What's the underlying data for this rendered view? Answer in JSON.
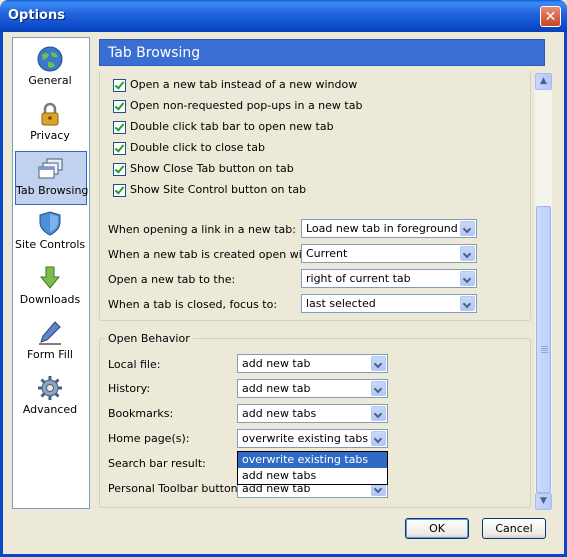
{
  "window": {
    "title": "Options",
    "close_glyph": "✕"
  },
  "sidebar": {
    "items": [
      {
        "label": "General",
        "icon": "globe-icon"
      },
      {
        "label": "Privacy",
        "icon": "lock-icon"
      },
      {
        "label": "Tab Browsing",
        "icon": "windows-icon",
        "selected": true
      },
      {
        "label": "Site Controls",
        "icon": "shield-icon"
      },
      {
        "label": "Downloads",
        "icon": "download-arrow-icon"
      },
      {
        "label": "Form Fill",
        "icon": "pen-icon"
      },
      {
        "label": "Advanced",
        "icon": "gear-icon"
      }
    ]
  },
  "header": {
    "title": "Tab Browsing"
  },
  "checkboxes": [
    {
      "label": "Open a new tab instead of a new window",
      "checked": true
    },
    {
      "label": "Open non-requested pop-ups in a new tab",
      "checked": true
    },
    {
      "label": "Double click tab bar to open new tab",
      "checked": true
    },
    {
      "label": "Double click to close tab",
      "checked": true
    },
    {
      "label": "Show Close Tab button on tab",
      "checked": true
    },
    {
      "label": "Show Site Control button on tab",
      "checked": true
    }
  ],
  "tab_settings": [
    {
      "label": "When opening a link in a new tab:",
      "value": "Load new tab in foreground"
    },
    {
      "label": "When a new tab is created open with:",
      "value": "Current"
    },
    {
      "label": "Open a new tab to the:",
      "value": "right of current tab"
    },
    {
      "label": "When a tab is closed, focus to:",
      "value": "last selected"
    }
  ],
  "open_behavior": {
    "legend": "Open Behavior",
    "rows": [
      {
        "label": "Local file:",
        "value": "add new tab"
      },
      {
        "label": "History:",
        "value": "add new tab"
      },
      {
        "label": "Bookmarks:",
        "value": "add new tabs"
      },
      {
        "label": "Home page(s):",
        "value": "overwrite existing tabs"
      },
      {
        "label": "Search bar result:",
        "value": ""
      },
      {
        "label": "Personal Toolbar button:",
        "value": "add new tab"
      }
    ],
    "dropdown_options": [
      {
        "label": "overwrite existing tabs",
        "highlighted": true
      },
      {
        "label": "add new tabs",
        "highlighted": false
      }
    ]
  },
  "buttons": {
    "ok": "OK",
    "cancel": "Cancel"
  },
  "colors": {
    "header_bg": "#3a6ed3",
    "selection": "#316ac5",
    "titlebar": "#0848c9"
  }
}
